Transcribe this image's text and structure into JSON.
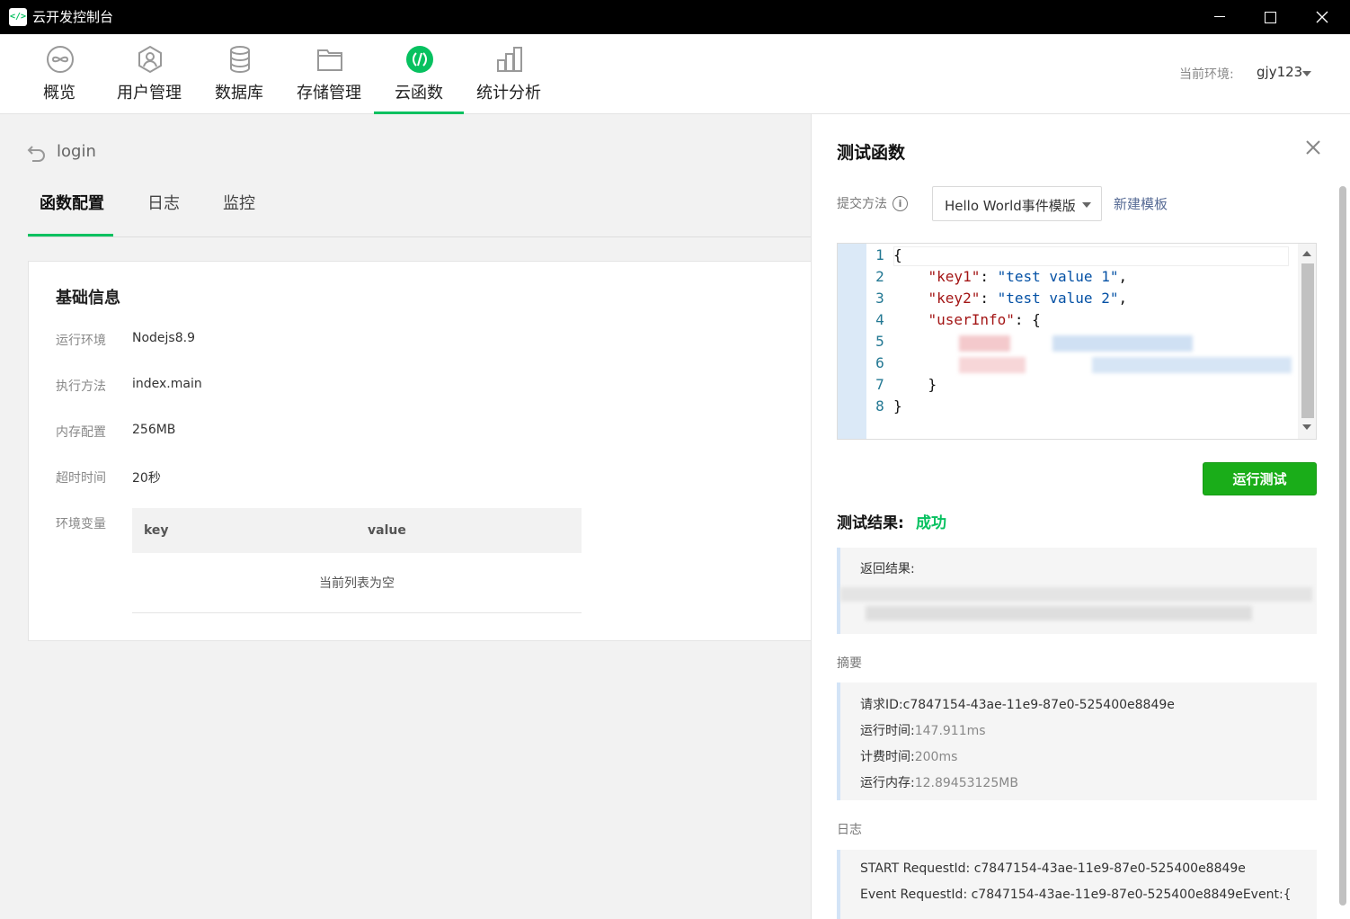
{
  "window": {
    "title": "云开发控制台",
    "icon_text": "</>"
  },
  "nav": {
    "items": [
      {
        "label": "概览",
        "icon": "overview-icon"
      },
      {
        "label": "用户管理",
        "icon": "user-icon"
      },
      {
        "label": "数据库",
        "icon": "database-icon"
      },
      {
        "label": "存储管理",
        "icon": "folder-icon"
      },
      {
        "label": "云函数",
        "icon": "cloud-function-icon"
      },
      {
        "label": "统计分析",
        "icon": "chart-icon"
      }
    ],
    "active_index": 4,
    "env_label": "当前环境:",
    "env_value": "gjy123"
  },
  "function": {
    "name": "login",
    "tabs": [
      "函数配置",
      "日志",
      "监控"
    ],
    "active_tab": 0,
    "basic_info": {
      "title": "基础信息",
      "runtime_label": "运行环境",
      "runtime_value": "Nodejs8.9",
      "handler_label": "执行方法",
      "handler_value": "index.main",
      "memory_label": "内存配置",
      "memory_value": "256MB",
      "timeout_label": "超时时间",
      "timeout_value": "20秒",
      "env_vars_label": "环境变量",
      "env_table": {
        "col_key": "key",
        "col_value": "value",
        "empty_text": "当前列表为空"
      }
    }
  },
  "test_panel": {
    "title": "测试函数",
    "submit_label": "提交方法",
    "template_selected": "Hello World事件模版",
    "new_template_link": "新建模板",
    "code_lines": [
      {
        "no": "1",
        "indent": "",
        "key": "",
        "value": "",
        "plain": "{"
      },
      {
        "no": "2",
        "indent": "    ",
        "key": "\"key1\"",
        "value": "\"test value 1\"",
        "plain": ","
      },
      {
        "no": "3",
        "indent": "    ",
        "key": "\"key2\"",
        "value": "\"test value 2\"",
        "plain": ","
      },
      {
        "no": "4",
        "indent": "    ",
        "key": "\"userInfo\"",
        "value": "",
        "plain": ": {"
      },
      {
        "no": "5",
        "indent": "",
        "key": "",
        "value": "",
        "plain": ""
      },
      {
        "no": "6",
        "indent": "",
        "key": "",
        "value": "",
        "plain": ""
      },
      {
        "no": "7",
        "indent": "    ",
        "key": "",
        "value": "",
        "plain": "}"
      },
      {
        "no": "8",
        "indent": "",
        "key": "",
        "value": "",
        "plain": "}"
      }
    ],
    "run_button": "运行测试",
    "result_label": "测试结果:",
    "result_status": "成功",
    "return_label": "返回结果:",
    "summary_label": "摘要",
    "summary": {
      "request_id_label": "请求ID:",
      "request_id": "c7847154-43ae-11e9-87e0-525400e8849e",
      "run_time_label": "运行时间:",
      "run_time": "147.911ms",
      "billed_time_label": "计费时间:",
      "billed_time": "200ms",
      "memory_label": "运行内存:",
      "memory": "12.89453125MB"
    },
    "log_label": "日志",
    "logs": [
      "START RequestId: c7847154-43ae-11e9-87e0-525400e8849e",
      "Event RequestId: c7847154-43ae-11e9-87e0-525400e8849eEvent:{"
    ]
  },
  "colors": {
    "accent": "#07c160",
    "run_button": "#1aad19",
    "link": "#576b95"
  }
}
